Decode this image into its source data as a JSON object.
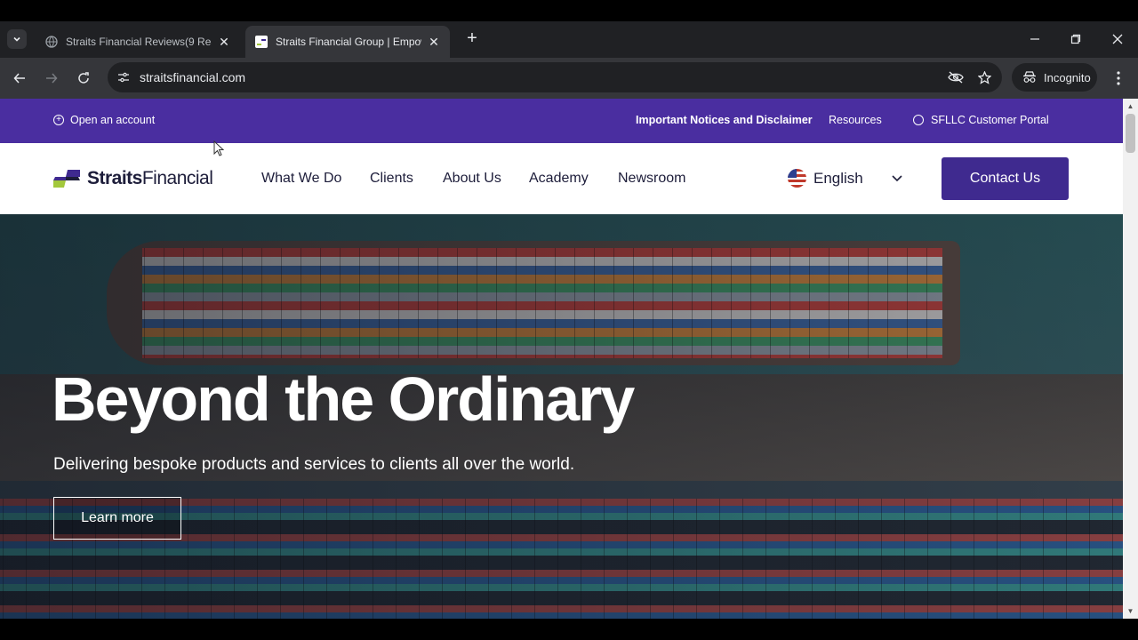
{
  "browser": {
    "tabs": [
      {
        "title": "Straits Financial Reviews(9 Reas",
        "active": false
      },
      {
        "title": "Straits Financial Group | Empow",
        "active": true
      }
    ],
    "url": "straitsfinancial.com",
    "incognito_label": "Incognito"
  },
  "site": {
    "topbar": {
      "open_account": "Open an account",
      "notices": "Important Notices and Disclaimer",
      "resources": "Resources",
      "portal": "SFLLC Customer Portal"
    },
    "logo": {
      "word1": "Straits",
      "word2": "Financial"
    },
    "nav": {
      "items": [
        "What We Do",
        "Clients",
        "About Us",
        "Academy",
        "Newsroom"
      ],
      "language": "English",
      "contact": "Contact Us"
    },
    "hero": {
      "title": "Beyond the Ordinary",
      "subtitle": "Delivering bespoke products and services to clients all over the world.",
      "cta": "Learn more"
    }
  },
  "colors": {
    "brand_purple": "#4a2ea0",
    "button_purple": "#3f2a8f"
  }
}
